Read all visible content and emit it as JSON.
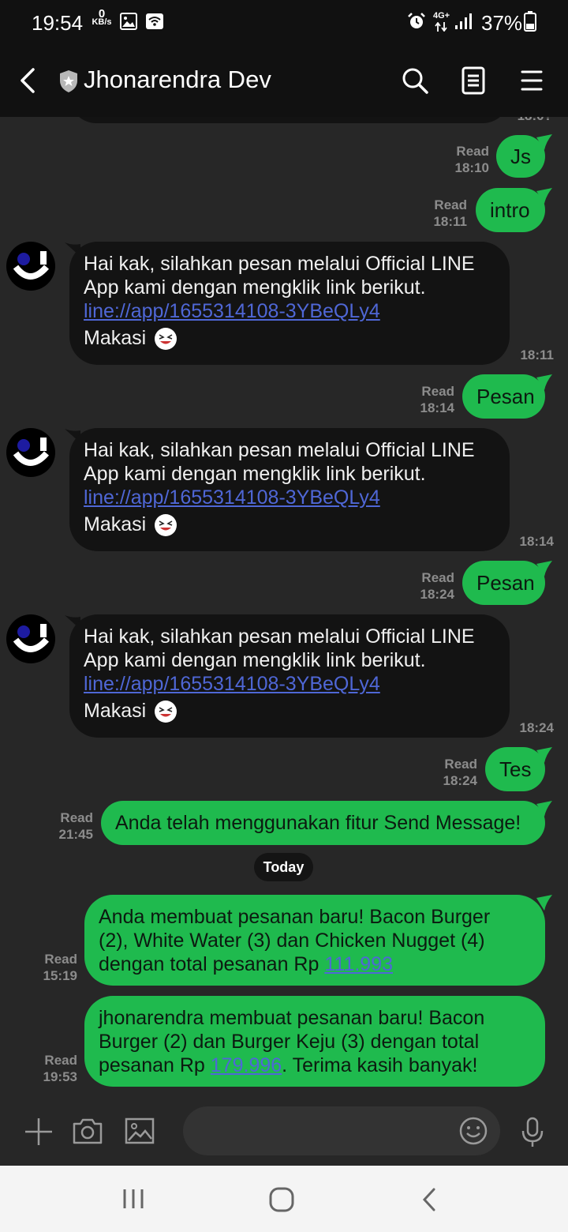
{
  "status_bar": {
    "time": "19:54",
    "net_speed_value": "0",
    "net_speed_unit": "KB/s",
    "network": "4G+",
    "battery": "37%"
  },
  "header": {
    "title": "Jhonarendra Dev",
    "icons": [
      "back-arrow-icon",
      "shield-star-icon",
      "search-icon",
      "notes-icon",
      "menu-icon"
    ]
  },
  "messages": [
    {
      "direction": "out",
      "text": "Js",
      "status": "Read",
      "time": "18:10"
    },
    {
      "direction": "out",
      "text": "intro",
      "status": "Read",
      "time": "18:11"
    },
    {
      "direction": "in",
      "line1": "Hai kak, silahkan pesan melalui Official LINE",
      "line2": "App kami dengan mengklik link berikut.",
      "link": "line://app/1655314108-3YBeQLy4",
      "closing": "Makasi",
      "time": "18:11"
    },
    {
      "direction": "out",
      "text": "Pesan",
      "status": "Read",
      "time": "18:14"
    },
    {
      "direction": "in",
      "line1": "Hai kak, silahkan pesan melalui Official LINE",
      "line2": "App kami dengan mengklik link berikut.",
      "link": "line://app/1655314108-3YBeQLy4",
      "closing": "Makasi",
      "time": "18:14"
    },
    {
      "direction": "out",
      "text": "Pesan",
      "status": "Read",
      "time": "18:24"
    },
    {
      "direction": "in",
      "line1": "Hai kak, silahkan pesan melalui Official LINE",
      "line2": "App kami dengan mengklik link berikut.",
      "link": "line://app/1655314108-3YBeQLy4",
      "closing": "Makasi",
      "time": "18:24"
    },
    {
      "direction": "out",
      "text": "Tes",
      "status": "Read",
      "time": "18:24"
    },
    {
      "direction": "out",
      "text": "Anda telah menggunakan fitur Send Message!",
      "status": "Read",
      "time": "21:45"
    },
    {
      "direction": "out",
      "line1": "Anda membuat pesanan baru! Bacon Burger",
      "line2": "(2), White Water (3) dan Chicken Nugget (4)",
      "line3_prefix": "dengan total pesanan Rp ",
      "amount": "111.993",
      "status": "Read",
      "time": "15:19"
    },
    {
      "direction": "out",
      "line1": "jhonarendra membuat pesanan baru! Bacon",
      "line2": "Burger (2) dan Burger Keju (3) dengan total",
      "line3_prefix": "pesanan Rp ",
      "amount": "179.996",
      "line3_suffix": ". Terima kasih banyak!",
      "status": "Read",
      "time": "19:53"
    }
  ],
  "date_separator": "Today",
  "input_bar": {
    "icons": [
      "plus-icon",
      "camera-icon",
      "image-icon",
      "emoji-icon",
      "microphone-icon"
    ]
  },
  "nav_bar": {
    "icons": [
      "recents-icon",
      "home-icon",
      "back-icon"
    ]
  },
  "colors": {
    "outgoing_bubble": "#1fba4e",
    "incoming_bubble": "#131313",
    "chat_background": "#272727",
    "header_background": "#111111",
    "link": "#4f67d6"
  }
}
